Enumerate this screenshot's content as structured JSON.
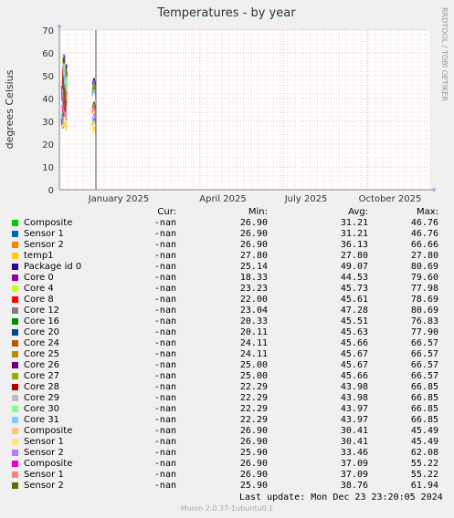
{
  "chart_data": {
    "type": "line",
    "title": "Temperatures - by year",
    "ylabel": "degrees Celsius",
    "ylim": [
      0,
      70
    ],
    "yticks": [
      0,
      10,
      20,
      30,
      40,
      50,
      60,
      70
    ],
    "xticks": [
      "January 2025",
      "April 2025",
      "July 2025",
      "October 2025"
    ],
    "grid": true,
    "side_label": "RRDTOOL / TOBI OETIKER",
    "columns": [
      "Cur:",
      "Min:",
      "Avg:",
      "Max:"
    ],
    "series": [
      {
        "name": "Composite",
        "color": "#00cc00",
        "cur": "-nan",
        "min": "26.90",
        "avg": "31.21",
        "max": "46.76"
      },
      {
        "name": "Sensor 1",
        "color": "#0066b3",
        "cur": "-nan",
        "min": "26.90",
        "avg": "31.21",
        "max": "46.76"
      },
      {
        "name": "Sensor 2",
        "color": "#ff8000",
        "cur": "-nan",
        "min": "26.90",
        "avg": "36.13",
        "max": "66.66"
      },
      {
        "name": "temp1",
        "color": "#ffcc00",
        "cur": "-nan",
        "min": "27.80",
        "avg": "27.80",
        "max": "27.80"
      },
      {
        "name": "Package id 0",
        "color": "#330099",
        "cur": "-nan",
        "min": "25.14",
        "avg": "49.07",
        "max": "80.69"
      },
      {
        "name": "Core 0",
        "color": "#990099",
        "cur": "-nan",
        "min": "18.33",
        "avg": "44.53",
        "max": "79.60"
      },
      {
        "name": "Core 4",
        "color": "#ccff00",
        "cur": "-nan",
        "min": "23.23",
        "avg": "45.73",
        "max": "77.98"
      },
      {
        "name": "Core 8",
        "color": "#ff0000",
        "cur": "-nan",
        "min": "22.00",
        "avg": "45.61",
        "max": "78.69"
      },
      {
        "name": "Core 12",
        "color": "#808080",
        "cur": "-nan",
        "min": "23.04",
        "avg": "47.28",
        "max": "80.69"
      },
      {
        "name": "Core 16",
        "color": "#008f00",
        "cur": "-nan",
        "min": "20.33",
        "avg": "45.51",
        "max": "76.83"
      },
      {
        "name": "Core 20",
        "color": "#00487d",
        "cur": "-nan",
        "min": "20.11",
        "avg": "45.63",
        "max": "77.90"
      },
      {
        "name": "Core 24",
        "color": "#b35a00",
        "cur": "-nan",
        "min": "24.11",
        "avg": "45.66",
        "max": "66.57"
      },
      {
        "name": "Core 25",
        "color": "#b38f00",
        "cur": "-nan",
        "min": "24.11",
        "avg": "45.67",
        "max": "66.57"
      },
      {
        "name": "Core 26",
        "color": "#6b006b",
        "cur": "-nan",
        "min": "25.00",
        "avg": "45.67",
        "max": "66.57"
      },
      {
        "name": "Core 27",
        "color": "#8fb300",
        "cur": "-nan",
        "min": "25.00",
        "avg": "45.66",
        "max": "66.57"
      },
      {
        "name": "Core 28",
        "color": "#b30000",
        "cur": "-nan",
        "min": "22.29",
        "avg": "43.98",
        "max": "66.85"
      },
      {
        "name": "Core 29",
        "color": "#bebebe",
        "cur": "-nan",
        "min": "22.29",
        "avg": "43.98",
        "max": "66.85"
      },
      {
        "name": "Core 30",
        "color": "#80ff80",
        "cur": "-nan",
        "min": "22.29",
        "avg": "43.97",
        "max": "66.85"
      },
      {
        "name": "Core 31",
        "color": "#80c9ff",
        "cur": "-nan",
        "min": "22.29",
        "avg": "43.97",
        "max": "66.85"
      },
      {
        "name": "Composite",
        "color": "#ffc080",
        "cur": "-nan",
        "min": "26.90",
        "avg": "30.41",
        "max": "45.49"
      },
      {
        "name": "Sensor 1",
        "color": "#ffe680",
        "cur": "-nan",
        "min": "26.90",
        "avg": "30.41",
        "max": "45.49"
      },
      {
        "name": "Sensor 2",
        "color": "#aa80ff",
        "cur": "-nan",
        "min": "25.90",
        "avg": "33.46",
        "max": "62.08"
      },
      {
        "name": "Composite",
        "color": "#ee00cc",
        "cur": "-nan",
        "min": "26.90",
        "avg": "37.09",
        "max": "55.22"
      },
      {
        "name": "Sensor 1",
        "color": "#ff8080",
        "cur": "-nan",
        "min": "26.90",
        "avg": "37.09",
        "max": "55.22"
      },
      {
        "name": "Sensor 2",
        "color": "#666600",
        "cur": "-nan",
        "min": "25.90",
        "avg": "38.76",
        "max": "61.94"
      }
    ],
    "last_update": "Last update: Mon Dec 23 23:20:05 2024",
    "footer": "Munin 2.0.37-1ubuntu0.1"
  }
}
